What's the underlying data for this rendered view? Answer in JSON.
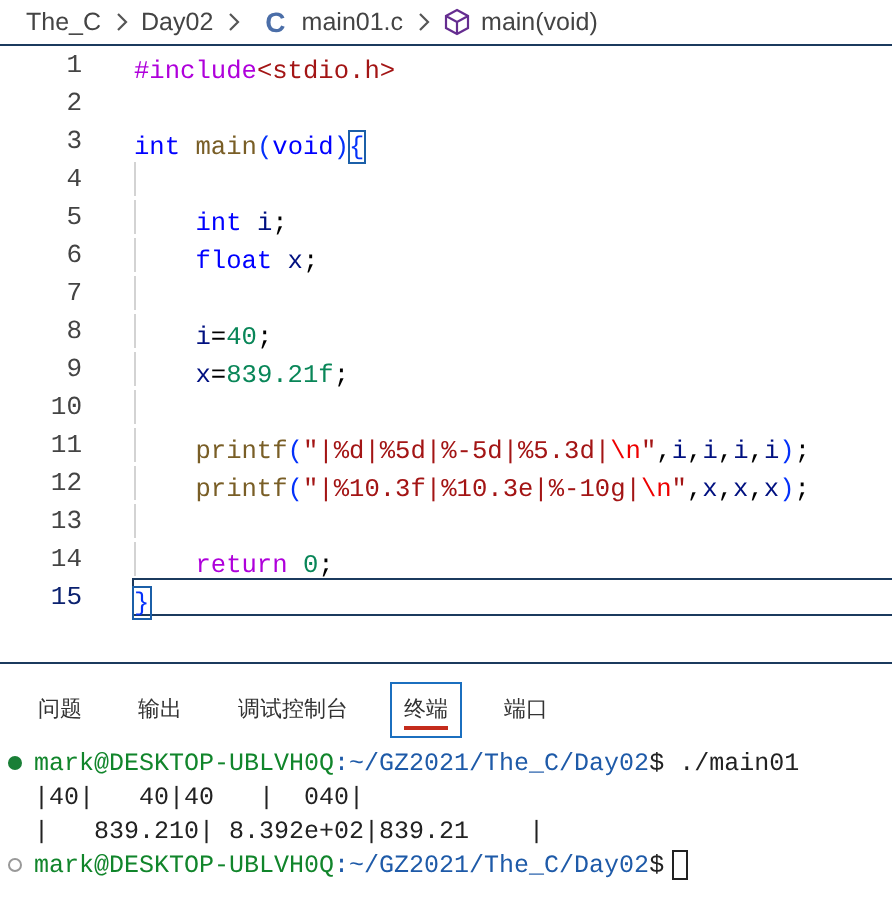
{
  "breadcrumbs": [
    {
      "kind": "folder",
      "label": "The_C"
    },
    {
      "kind": "folder",
      "label": "Day02"
    },
    {
      "kind": "file",
      "label": "main01.c",
      "icon_text": "C"
    },
    {
      "kind": "symbol",
      "label": "main(void)"
    }
  ],
  "editor": {
    "lines": [
      {
        "number": "1",
        "current": false,
        "segments": [
          {
            "t": "#include",
            "kind": "directive"
          },
          {
            "t": "<stdio.h>",
            "kind": "header"
          }
        ]
      },
      {
        "number": "2",
        "current": false
      },
      {
        "number": "3",
        "current": false,
        "segments": [
          {
            "t": "int",
            "kind": "type"
          },
          {
            "t": " main",
            "kind": "function"
          },
          {
            "t": "(",
            "kind": "paren"
          },
          {
            "t": "void",
            "kind": "type"
          },
          {
            "t": ")",
            "kind": "paren"
          },
          {
            "t": "{",
            "kind": "match"
          }
        ]
      },
      {
        "number": "4",
        "current": false
      },
      {
        "number": "5",
        "current": false,
        "segments": [
          {
            "t": "    int",
            "kind": "type"
          },
          {
            "t": " i",
            "kind": "variable"
          },
          {
            "t": ";",
            "kind": "plain"
          }
        ]
      },
      {
        "number": "6",
        "current": false,
        "segments": [
          {
            "t": "    float",
            "kind": "type"
          },
          {
            "t": " x",
            "kind": "variable"
          },
          {
            "t": ";",
            "kind": "plain"
          }
        ]
      },
      {
        "number": "7",
        "current": false
      },
      {
        "number": "8",
        "current": false,
        "segments": [
          {
            "t": "    i",
            "kind": "variable"
          },
          {
            "t": "=",
            "kind": "plain"
          },
          {
            "t": "40",
            "kind": "number"
          },
          {
            "t": ";",
            "kind": "plain"
          }
        ]
      },
      {
        "number": "9",
        "current": false,
        "segments": [
          {
            "t": "    x",
            "kind": "variable"
          },
          {
            "t": "=",
            "kind": "plain"
          },
          {
            "t": "839.21f",
            "kind": "number"
          },
          {
            "t": ";",
            "kind": "plain"
          }
        ]
      },
      {
        "number": "10",
        "current": false
      },
      {
        "number": "11",
        "current": false,
        "segments": [
          {
            "t": "    printf",
            "kind": "function"
          },
          {
            "t": "(",
            "kind": "paren"
          },
          {
            "t": "\"|%d|%5d|%-5d|%5.3d|",
            "kind": "string"
          },
          {
            "t": "\\n",
            "kind": "escape"
          },
          {
            "t": "\"",
            "kind": "string"
          },
          {
            "t": ",",
            "kind": "plain"
          },
          {
            "t": "i",
            "kind": "variable"
          },
          {
            "t": ",",
            "kind": "plain"
          },
          {
            "t": "i",
            "kind": "variable"
          },
          {
            "t": ",",
            "kind": "plain"
          },
          {
            "t": "i",
            "kind": "variable"
          },
          {
            "t": ",",
            "kind": "plain"
          },
          {
            "t": "i",
            "kind": "variable"
          },
          {
            "t": ")",
            "kind": "paren"
          },
          {
            "t": ";",
            "kind": "plain"
          }
        ]
      },
      {
        "number": "12",
        "current": false,
        "segments": [
          {
            "t": "    printf",
            "kind": "function"
          },
          {
            "t": "(",
            "kind": "paren"
          },
          {
            "t": "\"|%10.3f|%10.3e|%-10g|",
            "kind": "string"
          },
          {
            "t": "\\n",
            "kind": "escape"
          },
          {
            "t": "\"",
            "kind": "string"
          },
          {
            "t": ",",
            "kind": "plain"
          },
          {
            "t": "x",
            "kind": "variable"
          },
          {
            "t": ",",
            "kind": "plain"
          },
          {
            "t": "x",
            "kind": "variable"
          },
          {
            "t": ",",
            "kind": "plain"
          },
          {
            "t": "x",
            "kind": "variable"
          },
          {
            "t": ")",
            "kind": "paren"
          },
          {
            "t": ";",
            "kind": "plain"
          }
        ]
      },
      {
        "number": "13",
        "current": false
      },
      {
        "number": "14",
        "current": false,
        "segments": [
          {
            "t": "    return",
            "kind": "control"
          },
          {
            "t": " 0",
            "kind": "number"
          },
          {
            "t": ";",
            "kind": "plain"
          }
        ]
      },
      {
        "number": "15",
        "current": true,
        "segments": [
          {
            "t": "}",
            "kind": "match"
          }
        ]
      }
    ]
  },
  "panel": {
    "tabs": [
      {
        "label": "问题",
        "selected": false
      },
      {
        "label": "输出",
        "selected": false
      },
      {
        "label": "调试控制台",
        "selected": false
      },
      {
        "label": "终端",
        "selected": true
      },
      {
        "label": "端口",
        "selected": false
      }
    ],
    "terminal": [
      {
        "kind": "prompt",
        "done": true,
        "user": "mark@DESKTOP-UBLVH0Q",
        "path": ":~/GZ2021/The_C/Day02",
        "command": "$ ./main01"
      },
      {
        "kind": "output",
        "text": "|40|   40|40   |  040|"
      },
      {
        "kind": "output",
        "text": "|   839.210| 8.392e+02|839.21    |"
      },
      {
        "kind": "prompt",
        "done": false,
        "user": "mark@DESKTOP-UBLVH0Q",
        "path": ":~/GZ2021/The_C/Day02",
        "command": "$",
        "cursor": true
      }
    ]
  }
}
